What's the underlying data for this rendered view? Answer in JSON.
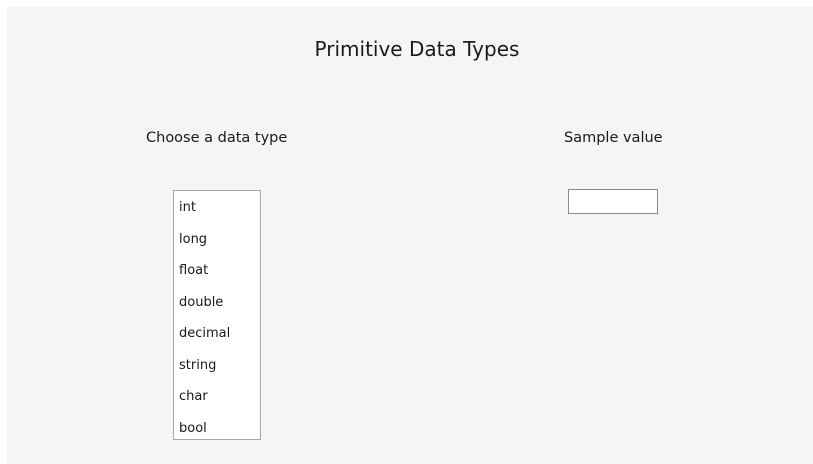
{
  "window": {
    "title": "Primitive Data Types"
  },
  "data_type_section": {
    "label": "Choose a data type",
    "options": [
      "int",
      "long",
      "float",
      "double",
      "decimal",
      "string",
      "char",
      "bool"
    ]
  },
  "sample_section": {
    "label": "Sample value",
    "value": ""
  }
}
